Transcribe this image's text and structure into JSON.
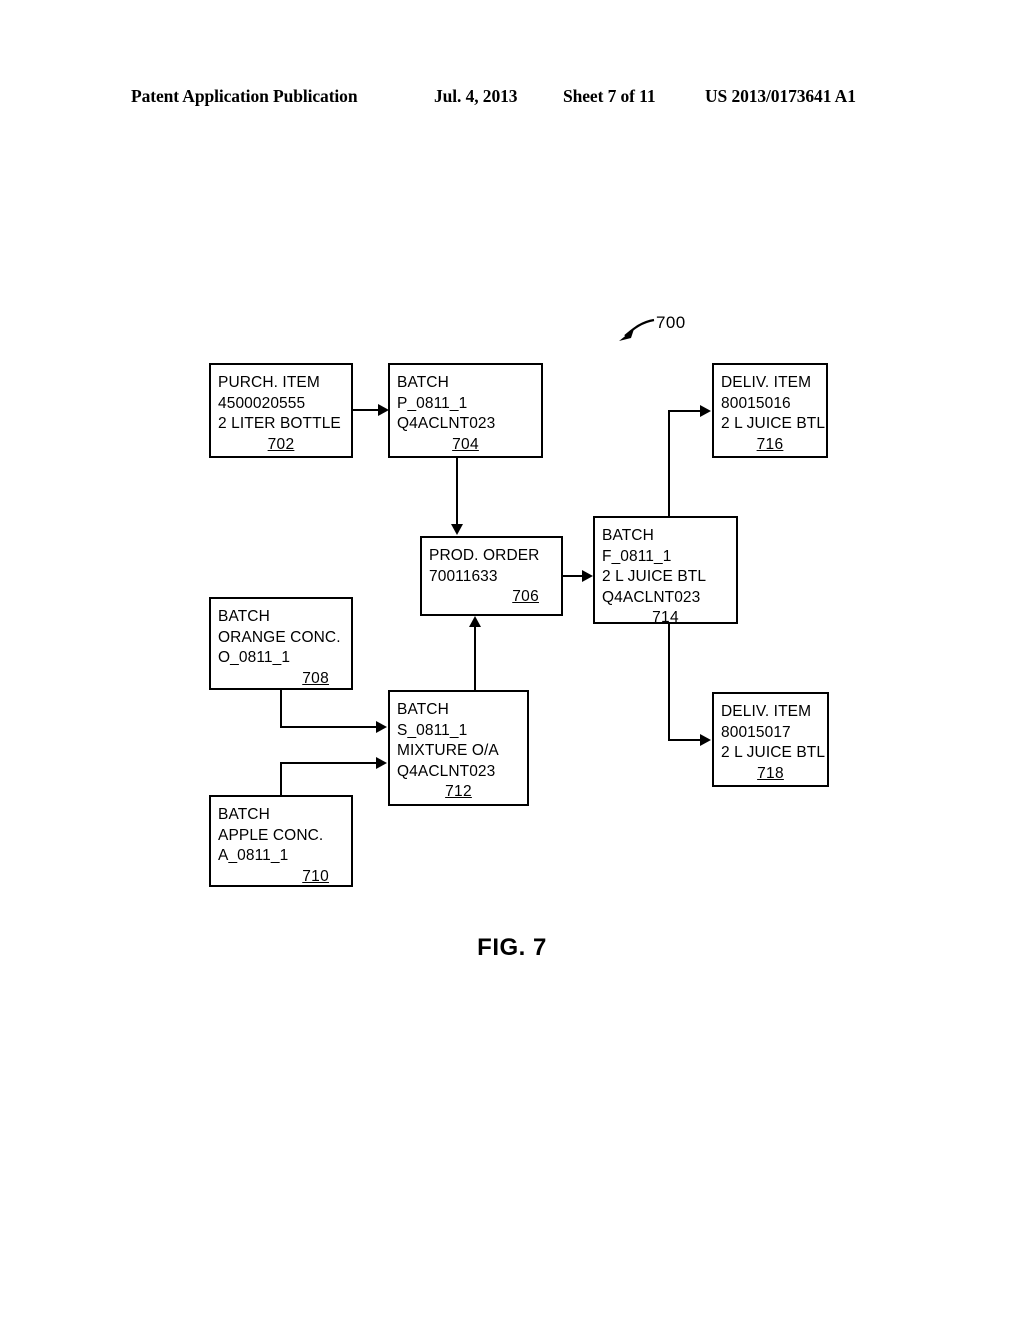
{
  "header": {
    "publication": "Patent Application Publication",
    "date": "Jul. 4, 2013",
    "sheet": "Sheet 7 of 11",
    "patent_number": "US 2013/0173641 A1"
  },
  "figure": {
    "caption": "FIG. 7",
    "diagram_reference": "700"
  },
  "nodes": {
    "n702": {
      "line1": "PURCH. ITEM",
      "line2": "4500020555",
      "line3": "2 LITER BOTTLE",
      "ref": "702"
    },
    "n704": {
      "line1": "BATCH",
      "line2": "P_0811_1",
      "line3": "Q4ACLNT023",
      "ref": "704"
    },
    "n706": {
      "line1": "PROD. ORDER",
      "line2": "70011633",
      "ref": "706"
    },
    "n708": {
      "line1": "BATCH",
      "line2": "ORANGE CONC.",
      "line3": "O_0811_1",
      "ref": "708"
    },
    "n710": {
      "line1": "BATCH",
      "line2": "APPLE CONC.",
      "line3": "A_0811_1",
      "ref": "710"
    },
    "n712": {
      "line1": "BATCH",
      "line2": "S_0811_1",
      "line3": "MIXTURE O/A",
      "line4": "Q4ACLNT023",
      "ref": "712"
    },
    "n714": {
      "line1": "BATCH",
      "line2": "F_0811_1",
      "line3": "2 L JUICE BTL",
      "line4": "Q4ACLNT023",
      "ref": "714"
    },
    "n716": {
      "line1": "DELIV. ITEM",
      "line2": "80015016",
      "line3": "2 L JUICE BTL",
      "ref": "716"
    },
    "n718": {
      "line1": "DELIV. ITEM",
      "line2": "80015017",
      "line3": "2 L JUICE BTL",
      "ref": "718"
    }
  },
  "colors": {
    "ink": "#000000",
    "paper": "#ffffff"
  }
}
